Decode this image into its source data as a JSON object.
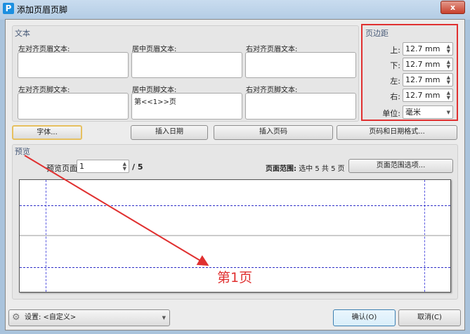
{
  "window": {
    "title": "添加页眉页脚",
    "close": "x",
    "app_icon": "P"
  },
  "text_group": {
    "title": "文本",
    "fields": [
      {
        "label": "左对齐页眉文本:",
        "value": ""
      },
      {
        "label": "居中页眉文本:",
        "value": ""
      },
      {
        "label": "右对齐页眉文本:",
        "value": ""
      },
      {
        "label": "左对齐页脚文本:",
        "value": ""
      },
      {
        "label": "居中页脚文本:",
        "value": "第<<1>>页"
      },
      {
        "label": "右对齐页脚文本:",
        "value": ""
      }
    ]
  },
  "margins": {
    "title": "页边距",
    "rows": [
      {
        "label": "上:",
        "value": "12.7 mm"
      },
      {
        "label": "下:",
        "value": "12.7 mm"
      },
      {
        "label": "左:",
        "value": "12.7 mm"
      },
      {
        "label": "右:",
        "value": "12.7 mm"
      }
    ],
    "unit_label": "单位:",
    "unit_value": "毫米"
  },
  "buttons": {
    "font": "字体...",
    "insert_date": "插入日期",
    "insert_page": "插入页码",
    "format": "页码和日期格式..."
  },
  "preview": {
    "title": "预览",
    "page_label": "预览页面",
    "page_value": "1",
    "page_total": "/ 5",
    "range_label": "页面范围:",
    "range_text": "选中 5 共 5 页",
    "range_button": "页面范围选项...",
    "footer_text": "第1页"
  },
  "bottom": {
    "settings": "设置: <自定义>",
    "ok": "确认(O)",
    "cancel": "取消(C)"
  },
  "colors": {
    "annotation": "#e03030",
    "guides": "#4040d0"
  }
}
